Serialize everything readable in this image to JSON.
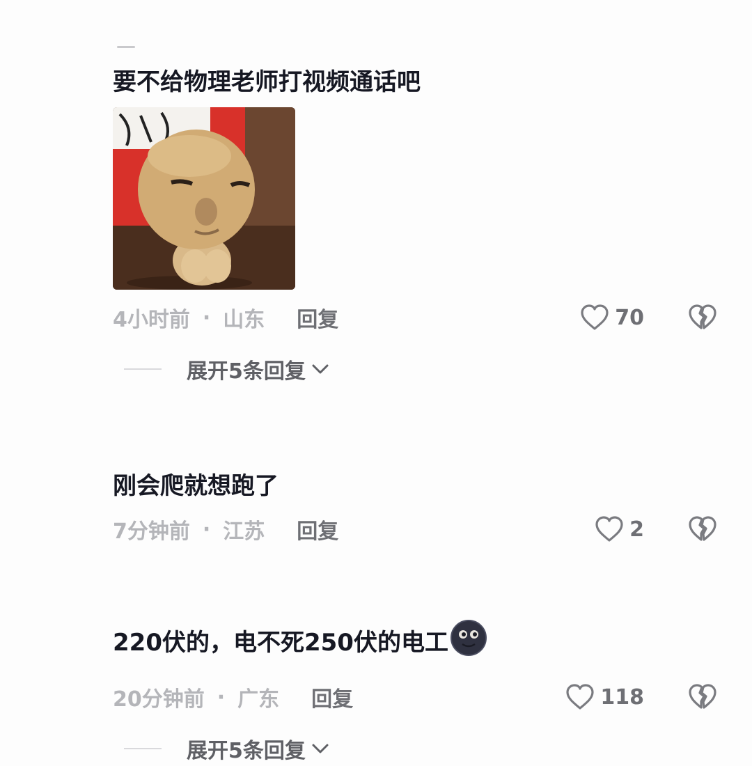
{
  "comments": [
    {
      "text": "要不给物理老师打视频通话吧",
      "sticker": "mushroom-plush-sticker",
      "time": "4小时前",
      "separator": "·",
      "location": "山东",
      "reply_label": "回复",
      "likes": "70",
      "expand_label": "展开5条回复"
    },
    {
      "text": "刚会爬就想跑了",
      "time": "7分钟前",
      "separator": "·",
      "location": "江苏",
      "reply_label": "回复",
      "likes": "2"
    },
    {
      "text": "220伏的，电不死250伏的电工",
      "emoji": "new-moon-face",
      "time": "20分钟前",
      "separator": "·",
      "location": "广东",
      "reply_label": "回复",
      "likes": "118",
      "expand_label": "展开5条回复"
    }
  ],
  "icons": {
    "like": "heart-outline-icon",
    "dislike": "broken-heart-icon",
    "expand": "chevron-down-icon"
  },
  "colors": {
    "primary_text": "#161823",
    "meta_text": "#b4b5b9",
    "action_text": "#6e6f74"
  }
}
